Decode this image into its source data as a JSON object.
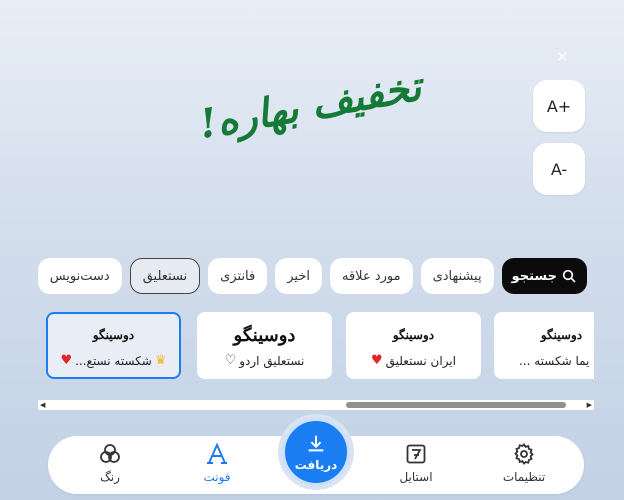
{
  "close_icon": "close-icon",
  "preview": {
    "text": "تخفیف بهاره!",
    "color": "#157a35"
  },
  "size_controls": {
    "increase": "A+",
    "decrease": "A-"
  },
  "tabs": [
    {
      "label": "جستجو",
      "icon": "search-icon",
      "type": "search"
    },
    {
      "label": "پیشنهادی"
    },
    {
      "label": "مورد علاقه"
    },
    {
      "label": "اخیر"
    },
    {
      "label": "فانتزی"
    },
    {
      "label": "نستعلیق",
      "selected": true
    },
    {
      "label": "دست‌نویس"
    }
  ],
  "font_cards": [
    {
      "preview": "دوسینگو",
      "name": "شکسته نستع...",
      "favorite": true,
      "premium": true,
      "selected": true
    },
    {
      "preview": "دوسینگو",
      "name": "نستعلیق اردو",
      "favorite": false,
      "premium": false
    },
    {
      "preview": "دوسینگو",
      "name": "ایران نستعلیق",
      "favorite": true,
      "premium": false
    },
    {
      "preview": "دوسینگو",
      "name": "یما شکسته ...",
      "favorite": false,
      "premium": true
    }
  ],
  "bottom_nav": {
    "settings": "تنظیمات",
    "style": "استایل",
    "download": "دریافت",
    "font": "فونت",
    "color": "رنگ"
  },
  "colors": {
    "accent": "#1b7df2",
    "favorite": "#e3242b",
    "premium": "#f2b620"
  }
}
